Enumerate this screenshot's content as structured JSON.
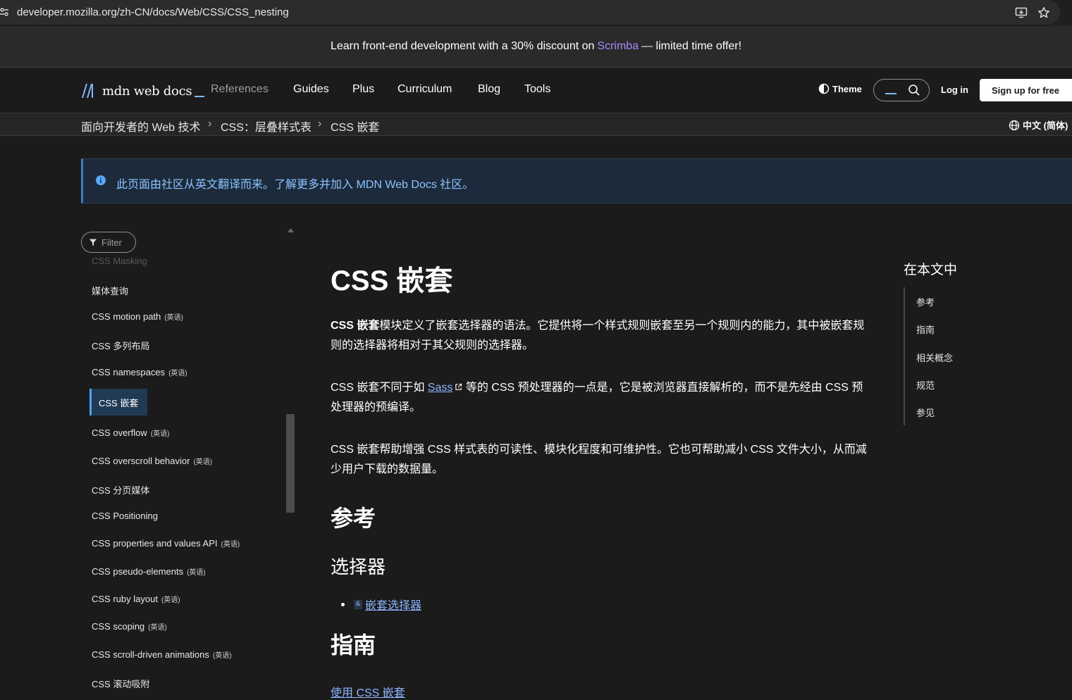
{
  "browser": {
    "url": "developer.mozilla.org/zh-CN/docs/Web/CSS/CSS_nesting"
  },
  "promo": {
    "before": "Learn front-end development with a 30% discount on",
    "link": "Scrimba",
    "after": "— limited time offer!"
  },
  "nav": {
    "logo_text": "mdn web docs",
    "items": [
      "References",
      "Guides",
      "Plus",
      "Curriculum",
      "Blog",
      "Tools"
    ],
    "theme": "Theme",
    "login": "Log in",
    "signup": "Sign up for free"
  },
  "breadcrumb": {
    "items": [
      "面向开发者的 Web 技术",
      "CSS：层叠样式表",
      "CSS 嵌套"
    ],
    "language": "中文 (简体)"
  },
  "notice": {
    "text": "此页面由社区从英文翻译而来。了解更多并加入 MDN Web Docs 社区。"
  },
  "sidebar": {
    "filter_placeholder": "Filter",
    "faded_item": "CSS Masking",
    "items": [
      {
        "label": "媒体查询",
        "tag": ""
      },
      {
        "label": "CSS motion path",
        "tag": "(英语)"
      },
      {
        "label": "CSS 多列布局",
        "tag": ""
      },
      {
        "label": "CSS namespaces",
        "tag": "(英语)"
      },
      {
        "label": "CSS 嵌套",
        "tag": "",
        "active": true
      },
      {
        "label": "CSS overflow",
        "tag": "(英语)"
      },
      {
        "label": "CSS overscroll behavior",
        "tag": "(英语)"
      },
      {
        "label": "CSS 分页媒体",
        "tag": ""
      },
      {
        "label": "CSS Positioning",
        "tag": ""
      },
      {
        "label": "CSS properties and values API",
        "tag": "(英语)"
      },
      {
        "label": "CSS pseudo-elements",
        "tag": "(英语)"
      },
      {
        "label": "CSS ruby layout",
        "tag": "(英语)"
      },
      {
        "label": "CSS scoping",
        "tag": "(英语)"
      },
      {
        "label": "CSS scroll-driven animations",
        "tag": "(英语)"
      },
      {
        "label": "CSS 滚动吸附",
        "tag": ""
      }
    ]
  },
  "article": {
    "title": "CSS 嵌套",
    "p1_bold": "CSS 嵌套",
    "p1_rest": "模块定义了嵌套选择器的语法。它提供将一个样式规则嵌套至另一个规则内的能力，其中被嵌套规则的选择器将相对于其父规则的选择器。",
    "p2_before": "CSS 嵌套不同于如 ",
    "p2_link": "Sass",
    "p2_after": " 等的 CSS 预处理器的一点是，它是被浏览器直接解析的，而不是先经由 CSS 预处理器的预编译。",
    "p3": "CSS 嵌套帮助增强 CSS 样式表的可读性、模块化程度和可维护性。它也可帮助减小 CSS 文件大小，从而减少用户下载的数据量。",
    "h_reference": "参考",
    "h_selectors": "选择器",
    "selector_badge": "&",
    "selector_link": "嵌套选择器",
    "h_guides": "指南",
    "guide_link": "使用 CSS 嵌套"
  },
  "toc": {
    "title": "在本文中",
    "items": [
      "参考",
      "指南",
      "相关概念",
      "规范",
      "参见"
    ]
  }
}
